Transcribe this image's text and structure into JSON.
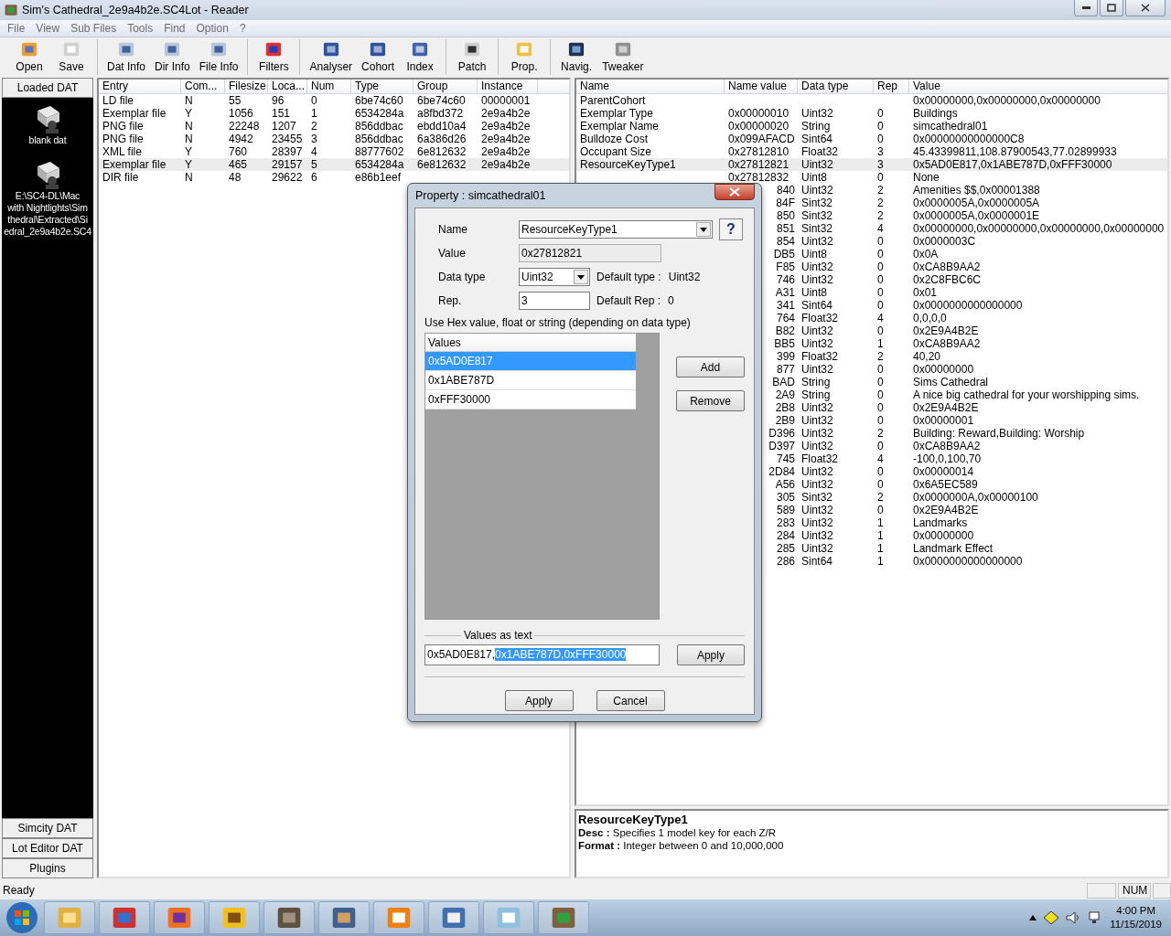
{
  "window": {
    "title": "Sim's Cathedral_2e9a4b2e.SC4Lot - Reader"
  },
  "menu": [
    "File",
    "View",
    "Sub Files",
    "Tools",
    "Find",
    "Option",
    "?"
  ],
  "toolbar": [
    [
      "Open",
      "Save"
    ],
    [
      "Dat Info",
      "Dir Info",
      "File Info"
    ],
    [
      "Filters"
    ],
    [
      "Analyser",
      "Cohort",
      "Index"
    ],
    [
      "Patch"
    ],
    [
      "Prop."
    ],
    [
      "Navig.",
      "Tweaker"
    ]
  ],
  "sidebar": {
    "header": "Loaded DAT",
    "items": [
      {
        "lines": [
          "blank dat"
        ]
      },
      {
        "lines": [
          "E:\\SC4-DL\\Mac",
          "with Nightlights\\Sim",
          "thedral\\Extracted\\Si",
          "edral_2e9a4b2e.SC4"
        ]
      }
    ],
    "buttons": [
      "Simcity DAT",
      "Lot Editor DAT",
      "Plugins"
    ]
  },
  "entries": {
    "columns": [
      "Entry",
      "Com...",
      "Filesize",
      "Loca...",
      "Num",
      "Type",
      "Group",
      "Instance"
    ],
    "rows": [
      {
        "cells": [
          "LD file",
          "N",
          "55",
          "96",
          "0",
          "6be74c60",
          "6be74c60",
          "00000001"
        ],
        "selected": false
      },
      {
        "cells": [
          "Exemplar file",
          "Y",
          "1056",
          "151",
          "1",
          "6534284a",
          "a8fbd372",
          "2e9a4b2e"
        ],
        "selected": false
      },
      {
        "cells": [
          "PNG file",
          "N",
          "22248",
          "1207",
          "2",
          "856ddbac",
          "ebdd10a4",
          "2e9a4b2e"
        ],
        "selected": false
      },
      {
        "cells": [
          "PNG file",
          "N",
          "4942",
          "23455",
          "3",
          "856ddbac",
          "6a386d26",
          "2e9a4b2e"
        ],
        "selected": false
      },
      {
        "cells": [
          "XML file",
          "Y",
          "760",
          "28397",
          "4",
          "88777602",
          "6e812632",
          "2e9a4b2e"
        ],
        "selected": false
      },
      {
        "cells": [
          "Exemplar file",
          "Y",
          "465",
          "29157",
          "5",
          "6534284a",
          "6e812632",
          "2e9a4b2e"
        ],
        "selected": true
      },
      {
        "cells": [
          "DIR file",
          "N",
          "48",
          "29622",
          "6",
          "e86b1eef"
        ],
        "selected": false
      }
    ]
  },
  "properties": {
    "columns": [
      "Name",
      "Name value",
      "Data type",
      "Rep",
      "Value"
    ],
    "rows": [
      {
        "kind": "row",
        "name": "ParentCohort",
        "value": "0x00000000,0x00000000,0x00000000",
        "selected": false
      },
      {
        "kind": "row",
        "name": "Exemplar Type",
        "name_value": "0x00000010",
        "data_type": "Uint32",
        "rep": "0",
        "value": "Buildings",
        "selected": false
      },
      {
        "kind": "row",
        "name": "Exemplar Name",
        "name_value": "0x00000020",
        "data_type": "String",
        "rep": "0",
        "value": "simcathedral01",
        "selected": false
      },
      {
        "kind": "row",
        "name": "Bulldoze Cost",
        "name_value": "0x099AFACD",
        "data_type": "Sint64",
        "rep": "0",
        "value": "0x00000000000000C8",
        "selected": false
      },
      {
        "kind": "row",
        "name": "Occupant Size",
        "name_value": "0x27812810",
        "data_type": "Float32",
        "rep": "3",
        "value": "45.43399811,108.87900543,77.02899933",
        "selected": false
      },
      {
        "kind": "row",
        "name": "ResourceKeyType1",
        "name_value": "0x27812821",
        "data_type": "Uint32",
        "rep": "3",
        "value": "0x5AD0E817,0x1ABE787D,0xFFF30000",
        "selected": true
      },
      {
        "kind": "row",
        "name_value": "0x27812832",
        "data_type": "Uint8",
        "rep": "0",
        "value": "None",
        "selected": false
      },
      {
        "kind": "covered",
        "name_value": "840",
        "data_type": "Uint32",
        "rep": "2",
        "value": "Amenities $$,0x00001388",
        "selected": false
      },
      {
        "kind": "covered",
        "name_value": "84F",
        "data_type": "Sint32",
        "rep": "2",
        "value": "0x0000005A,0x0000005A",
        "selected": false
      },
      {
        "kind": "covered",
        "name_value": "850",
        "data_type": "Sint32",
        "rep": "2",
        "value": "0x0000005A,0x0000001E",
        "selected": false
      },
      {
        "kind": "covered",
        "name_value": "851",
        "data_type": "Sint32",
        "rep": "4",
        "value": "0x00000000,0x00000000,0x00000000,0x00000000",
        "selected": false
      },
      {
        "kind": "covered",
        "name_value": "854",
        "data_type": "Uint32",
        "rep": "0",
        "value": "0x0000003C",
        "selected": false
      },
      {
        "kind": "covered",
        "name_value": "DB5",
        "data_type": "Uint8",
        "rep": "0",
        "value": "0x0A",
        "selected": false
      },
      {
        "kind": "covered",
        "name_value": "F85",
        "data_type": "Uint32",
        "rep": "0",
        "value": "0xCA8B9AA2",
        "selected": false
      },
      {
        "kind": "covered",
        "name_value": "746",
        "data_type": "Uint32",
        "rep": "0",
        "value": "0x2C8FBC6C",
        "selected": false
      },
      {
        "kind": "covered",
        "name_value": "A31",
        "data_type": "Uint8",
        "rep": "0",
        "value": "0x01",
        "selected": false
      },
      {
        "kind": "covered",
        "name_value": "341",
        "data_type": "Sint64",
        "rep": "0",
        "value": "0x0000000000000000",
        "selected": false
      },
      {
        "kind": "covered",
        "name_value": "764",
        "data_type": "Float32",
        "rep": "4",
        "value": "0,0,0,0",
        "selected": false
      },
      {
        "kind": "covered",
        "name_value": "B82",
        "data_type": "Uint32",
        "rep": "0",
        "value": "0x2E9A4B2E",
        "selected": false
      },
      {
        "kind": "covered",
        "name_value": "BB5",
        "data_type": "Uint32",
        "rep": "1",
        "value": "0xCA8B9AA2",
        "selected": false
      },
      {
        "kind": "covered",
        "name_value": "399",
        "data_type": "Float32",
        "rep": "2",
        "value": "40,20",
        "selected": false
      },
      {
        "kind": "covered",
        "name_value": "877",
        "data_type": "Uint32",
        "rep": "0",
        "value": "0x00000000",
        "selected": false
      },
      {
        "kind": "covered",
        "name_value": "BAD",
        "data_type": "String",
        "rep": "0",
        "value": "Sims Cathedral",
        "selected": false
      },
      {
        "kind": "covered",
        "name_value": "2A9",
        "data_type": "String",
        "rep": "0",
        "value": "A nice big cathedral for your worshipping sims.",
        "selected": false
      },
      {
        "kind": "covered",
        "name_value": "2B8",
        "data_type": "Uint32",
        "rep": "0",
        "value": "0x2E9A4B2E",
        "selected": false
      },
      {
        "kind": "covered",
        "name_value": "2B9",
        "data_type": "Uint32",
        "rep": "0",
        "value": "0x00000001",
        "selected": false
      },
      {
        "kind": "covered",
        "name_value": "D396",
        "data_type": "Uint32",
        "rep": "2",
        "value": "Building: Reward,Building: Worship",
        "selected": false
      },
      {
        "kind": "covered",
        "name_value": "D397",
        "data_type": "Uint32",
        "rep": "0",
        "value": "0xCA8B9AA2",
        "selected": false
      },
      {
        "kind": "covered",
        "name_value": "745",
        "data_type": "Float32",
        "rep": "4",
        "value": "-100,0,100,70",
        "selected": false
      },
      {
        "kind": "covered",
        "name_value": "2D84",
        "data_type": "Uint32",
        "rep": "0",
        "value": "0x00000014",
        "selected": false
      },
      {
        "kind": "covered",
        "name_value": "A56",
        "data_type": "Uint32",
        "rep": "0",
        "value": "0x6A5EC589",
        "selected": false
      },
      {
        "kind": "covered",
        "name_value": "305",
        "data_type": "Sint32",
        "rep": "2",
        "value": "0x0000000A,0x00000100",
        "selected": false
      },
      {
        "kind": "covered",
        "name_value": "589",
        "data_type": "Uint32",
        "rep": "0",
        "value": "0x2E9A4B2E",
        "selected": false
      },
      {
        "kind": "covered",
        "name_value": "283",
        "data_type": "Uint32",
        "rep": "1",
        "value": "Landmarks",
        "selected": false
      },
      {
        "kind": "covered",
        "name_value": "284",
        "data_type": "Uint32",
        "rep": "1",
        "value": "0x00000000",
        "selected": false
      },
      {
        "kind": "covered",
        "name_value": "285",
        "data_type": "Uint32",
        "rep": "1",
        "value": "Landmark Effect",
        "selected": false
      },
      {
        "kind": "covered",
        "name_value": "286",
        "data_type": "Sint64",
        "rep": "1",
        "value": "0x0000000000000000",
        "selected": false
      }
    ]
  },
  "description": {
    "title": "ResourceKeyType1",
    "lines": [
      "**Desc :** Specifies 1 model key for each Z/R",
      "**Format :** Integer between 0 and 10,000,000"
    ]
  },
  "dialog": {
    "title": "Property : simcathedral01",
    "name_label": "Name",
    "name": "ResourceKeyType1",
    "help": "?",
    "value_label": "Value",
    "value": "0x27812821",
    "type_label": "Data type",
    "type": "Uint32",
    "default_type_label": "Default type :",
    "default_type": "Uint32",
    "rep_label": "Rep.",
    "rep": "3",
    "default_rep_label": "Default Rep :",
    "default_rep": "0",
    "hint": "Use Hex value, float or string (depending on data type)",
    "values_header": "Values",
    "values": [
      {
        "text": "0x5AD0E817",
        "selected": true
      },
      {
        "text": "0x1ABE787D",
        "selected": false
      },
      {
        "text": "0xFFF30000",
        "selected": false
      }
    ],
    "add": "Add",
    "remove": "Remove",
    "text_group": "Values as text",
    "text_value": "0x5AD0E817,",
    "text_selected": "0x1ABE787D,0xFFF30000",
    "text_apply": "Apply",
    "apply": "Apply",
    "cancel": "Cancel"
  },
  "status_bar": {
    "text": "Ready",
    "panels": [
      "NUM"
    ]
  },
  "clock": {
    "time": "4:00 PM",
    "date": "11/15/2019"
  }
}
